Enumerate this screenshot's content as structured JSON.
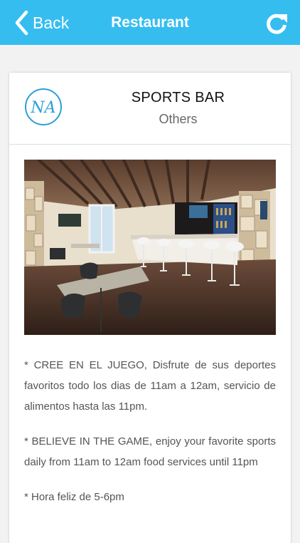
{
  "navbar": {
    "back_label": "Back",
    "title": "Restaurant",
    "back_icon": "chevron-left-icon",
    "refresh_icon": "refresh-icon"
  },
  "venue": {
    "logo_text": "NA",
    "name": "SPORTS BAR",
    "category": "Others",
    "photo_subject": "sports bar interior photo"
  },
  "description": [
    "* CREE EN EL JUEGO, Disfrute de sus deportes favoritos todo los dias de 11am a 12am, servicio de alimentos hasta las 11pm.",
    "* BELIEVE IN THE GAME, enjoy your favorite sports daily from 11am to 12am food services until 11pm",
    "* Hora feliz de 5-6pm"
  ],
  "colors": {
    "navbar": "#36bdf0",
    "nav_text": "#ffffff",
    "logo": "#2a9fd8",
    "body_text": "#555555",
    "background": "#f2f2f2"
  }
}
